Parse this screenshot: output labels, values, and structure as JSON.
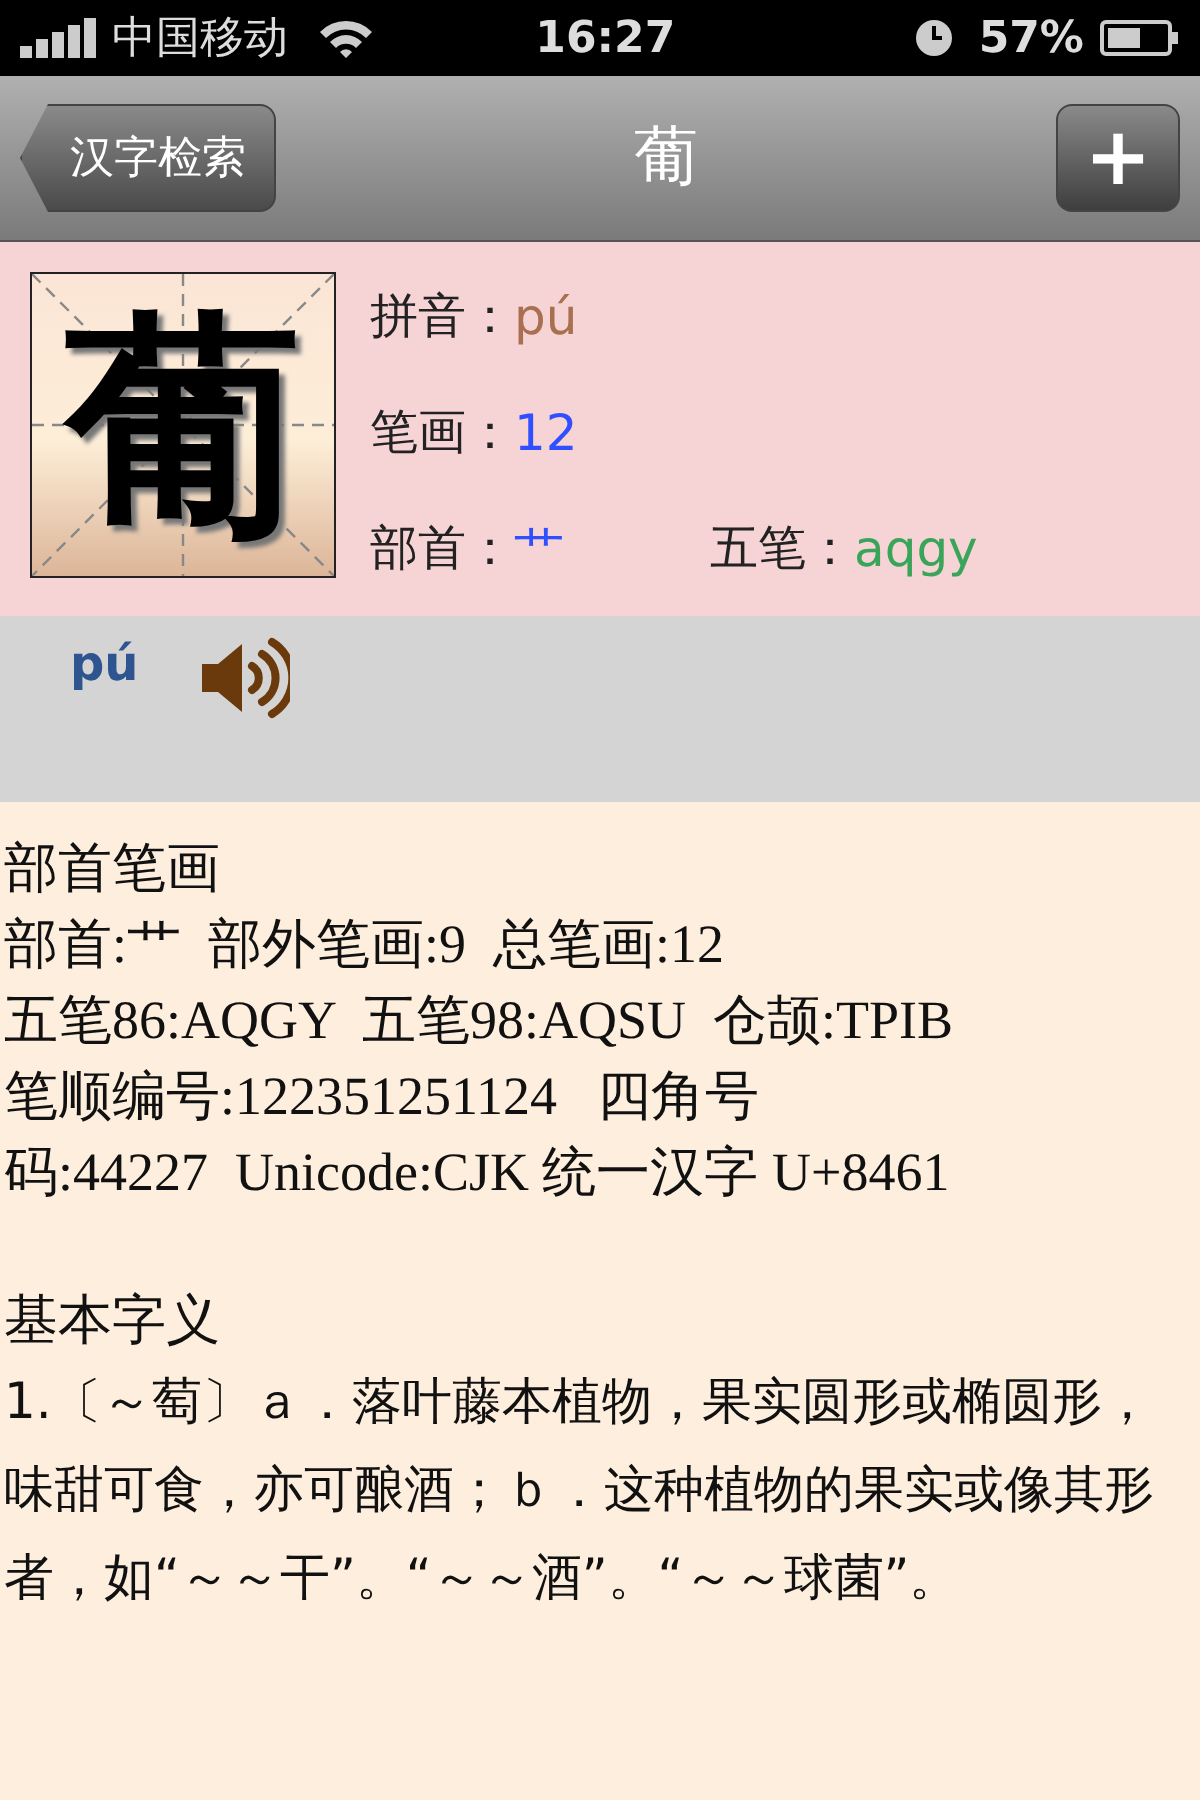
{
  "status_bar": {
    "carrier": "中国移动",
    "time": "16:27",
    "battery": "57%"
  },
  "nav": {
    "back": "汉字检索",
    "title": "葡",
    "action": "+"
  },
  "character": {
    "glyph": "葡",
    "fields": [
      {
        "label": "拼音：",
        "value": "pú",
        "color": "#a87050"
      },
      {
        "label": "笔画：",
        "value": "12",
        "color": "#3050ff"
      },
      {
        "label": "部首：",
        "value": "艹",
        "color": "#3050ff"
      },
      {
        "label": "五笔：",
        "value": "aqgy",
        "color": "#3aa55a"
      }
    ]
  },
  "pronunciation": {
    "pinyin": "pú"
  },
  "radical_section": {
    "heading": "部首笔画",
    "lines": [
      "部首:艹  部外笔画:9  总笔画:12",
      "五笔86:AQGY  五笔98:AQSU  仓颉:TPIB",
      "笔顺编号:122351251124   四角号",
      "码:44227  Unicode:CJK 统一汉字 U+8461"
    ]
  },
  "meaning_section": {
    "heading": "基本字义",
    "text": "1.〔～萄〕ａ．落叶藤本植物，果实圆形或椭圆形，味甜可食，亦可酿酒；ｂ．这种植物的果实或像其形者，如“～～干”。“～～酒”。“～～球菌”。"
  }
}
